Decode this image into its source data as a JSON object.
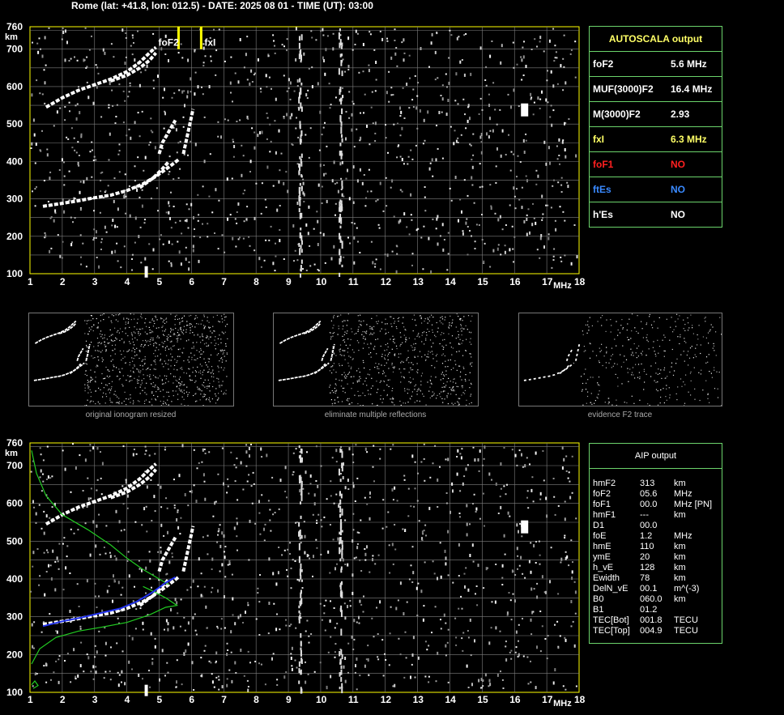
{
  "header": "Rome (lat: +41.8, lon: 012.5) - DATE: 2025 08 01 - TIME (UT): 03:00",
  "chart_data": [
    {
      "type": "scatter",
      "id": "ionogram-top",
      "x_ticks": [
        "1",
        "2",
        "3",
        "4",
        "5",
        "6",
        "7",
        "8",
        "9",
        "10",
        "11",
        "12",
        "13",
        "14",
        "15",
        "16",
        "17",
        "18"
      ],
      "y_ticks": [
        "100",
        "200",
        "300",
        "400",
        "500",
        "600",
        "700",
        "760"
      ],
      "x_unit": "MHz",
      "y_unit": "km",
      "xlim": [
        1,
        18
      ],
      "ylim": [
        100,
        760
      ],
      "grid": true,
      "markers": [
        {
          "name": "foF2",
          "x": 5.6,
          "color": "#ffff00"
        },
        {
          "name": "fxI",
          "x": 6.3,
          "color": "#ffff00"
        }
      ],
      "traces": [
        {
          "points": [
            [
              1.5,
              545
            ],
            [
              2.0,
              570
            ],
            [
              2.5,
              590
            ],
            [
              3.0,
              605
            ],
            [
              3.5,
              620
            ],
            [
              4.0,
              640
            ],
            [
              4.4,
              665
            ],
            [
              4.7,
              690
            ],
            [
              4.9,
              705
            ]
          ]
        },
        {
          "points": [
            [
              3.5,
              615
            ],
            [
              4.0,
              630
            ],
            [
              4.4,
              650
            ],
            [
              4.7,
              670
            ],
            [
              4.9,
              690
            ]
          ]
        },
        {
          "points": [
            [
              1.4,
              280
            ],
            [
              2.0,
              288
            ],
            [
              2.5,
              295
            ],
            [
              3.0,
              303
            ],
            [
              3.5,
              310
            ],
            [
              4.0,
              322
            ],
            [
              4.5,
              340
            ],
            [
              4.9,
              360
            ],
            [
              5.3,
              385
            ],
            [
              5.6,
              405
            ]
          ]
        },
        {
          "points": [
            [
              4.4,
              330
            ],
            [
              4.8,
              355
            ],
            [
              5.1,
              380
            ],
            [
              5.3,
              400
            ]
          ]
        },
        {
          "points": [
            [
              5.0,
              420
            ],
            [
              5.1,
              450
            ],
            [
              5.3,
              480
            ],
            [
              5.5,
              510
            ]
          ]
        },
        {
          "points": [
            [
              5.75,
              420
            ],
            [
              5.85,
              460
            ],
            [
              5.95,
              500
            ],
            [
              6.05,
              540
            ]
          ]
        }
      ]
    },
    {
      "type": "scatter",
      "id": "ionogram-bottom",
      "x_ticks": [
        "1",
        "2",
        "3",
        "4",
        "5",
        "6",
        "7",
        "8",
        "9",
        "10",
        "11",
        "12",
        "13",
        "14",
        "15",
        "16",
        "17",
        "18"
      ],
      "y_ticks": [
        "100",
        "200",
        "300",
        "400",
        "500",
        "600",
        "700",
        "760"
      ],
      "x_unit": "MHz",
      "y_unit": "km",
      "xlim": [
        1,
        18
      ],
      "ylim": [
        100,
        760
      ],
      "grid": true,
      "traces": [
        {
          "points": [
            [
              1.5,
              545
            ],
            [
              2.0,
              570
            ],
            [
              2.5,
              590
            ],
            [
              3.0,
              605
            ],
            [
              3.5,
              620
            ],
            [
              4.0,
              640
            ],
            [
              4.4,
              665
            ],
            [
              4.7,
              690
            ],
            [
              4.9,
              705
            ]
          ]
        },
        {
          "points": [
            [
              3.5,
              615
            ],
            [
              4.0,
              630
            ],
            [
              4.4,
              650
            ],
            [
              4.7,
              670
            ],
            [
              4.9,
              690
            ]
          ]
        },
        {
          "points": [
            [
              1.4,
              280
            ],
            [
              2.0,
              288
            ],
            [
              2.5,
              295
            ],
            [
              3.0,
              303
            ],
            [
              3.5,
              310
            ],
            [
              4.0,
              322
            ],
            [
              4.5,
              340
            ],
            [
              4.9,
              360
            ],
            [
              5.3,
              385
            ],
            [
              5.6,
              405
            ]
          ]
        },
        {
          "points": [
            [
              4.4,
              330
            ],
            [
              4.8,
              355
            ],
            [
              5.1,
              380
            ],
            [
              5.3,
              400
            ]
          ]
        },
        {
          "points": [
            [
              5.0,
              420
            ],
            [
              5.1,
              450
            ],
            [
              5.3,
              480
            ],
            [
              5.5,
              510
            ]
          ]
        },
        {
          "points": [
            [
              5.75,
              420
            ],
            [
              5.85,
              460
            ],
            [
              5.95,
              500
            ],
            [
              6.05,
              540
            ]
          ]
        }
      ],
      "lines": [
        {
          "color": "#22cc22",
          "points": [
            [
              1.05,
              740
            ],
            [
              1.2,
              680
            ],
            [
              1.5,
              620
            ],
            [
              2.0,
              570
            ],
            [
              2.8,
              530
            ],
            [
              3.5,
              490
            ],
            [
              4.0,
              455
            ],
            [
              4.5,
              425
            ],
            [
              5.0,
              400
            ],
            [
              5.3,
              385
            ]
          ]
        },
        {
          "color": "#22cc22",
          "points": [
            [
              1.05,
              175
            ],
            [
              1.3,
              215
            ],
            [
              1.8,
              245
            ],
            [
              2.5,
              262
            ],
            [
              3.2,
              272
            ],
            [
              4.0,
              285
            ],
            [
              4.7,
              305
            ],
            [
              5.2,
              325
            ],
            [
              5.55,
              330
            ],
            [
              5.2,
              350
            ],
            [
              4.8,
              368
            ],
            [
              4.5,
              380
            ]
          ]
        },
        {
          "color": "#22cc22",
          "points": [
            [
              1.05,
              120
            ],
            [
              1.15,
              130
            ],
            [
              1.25,
              118
            ],
            [
              1.1,
              110
            ]
          ]
        },
        {
          "color": "#2233ee",
          "points": [
            [
              1.4,
              275
            ],
            [
              2.0,
              288
            ],
            [
              2.6,
              298
            ],
            [
              3.2,
              310
            ],
            [
              3.8,
              322
            ],
            [
              4.3,
              340
            ],
            [
              4.8,
              365
            ],
            [
              5.2,
              390
            ],
            [
              5.5,
              405
            ]
          ]
        }
      ]
    }
  ],
  "thumbnails": [
    {
      "caption": "original ionogram resized"
    },
    {
      "caption": "eliminate multiple reflections"
    },
    {
      "caption": "evidence F2 trace"
    }
  ],
  "autoscala": {
    "title": "AUTOSCALA output",
    "rows": [
      {
        "label": "foF2",
        "value": "5.6 MHz",
        "label_color": "#ffffff",
        "value_color": "#ffffff"
      },
      {
        "label": "MUF(3000)F2",
        "value": "16.4 MHz",
        "label_color": "#ffffff",
        "value_color": "#ffffff"
      },
      {
        "label": "M(3000)F2",
        "value": "2.93",
        "label_color": "#ffffff",
        "value_color": "#ffffff"
      },
      {
        "label": "fxI",
        "value": "6.3 MHz",
        "label_color": "#ffff66",
        "value_color": "#ffff66"
      },
      {
        "label": "foF1",
        "value": "NO",
        "label_color": "#ff2020",
        "value_color": "#ff2020"
      },
      {
        "label": "ftEs",
        "value": "NO",
        "label_color": "#3a8aff",
        "value_color": "#3a8aff"
      },
      {
        "label": "h'Es",
        "value": "NO",
        "label_color": "#ffffff",
        "value_color": "#ffffff"
      }
    ]
  },
  "aip": {
    "title": "AIP output",
    "rows": [
      {
        "name": "hmF2",
        "value": "313",
        "unit": "km"
      },
      {
        "name": "foF2",
        "value": "05.6",
        "unit": "MHz"
      },
      {
        "name": "foF1",
        "value": "00.0",
        "unit": "MHz   [PN]"
      },
      {
        "name": "hmF1",
        "value": "---",
        "unit": "km"
      },
      {
        "name": "D1",
        "value": "00.0",
        "unit": ""
      },
      {
        "name": "foE",
        "value": "1.2",
        "unit": "MHz"
      },
      {
        "name": "hmE",
        "value": "110",
        "unit": "km"
      },
      {
        "name": "ymE",
        "value": "20",
        "unit": "km"
      },
      {
        "name": "h_vE",
        "value": "128",
        "unit": "km"
      },
      {
        "name": "Ewidth",
        "value": "78",
        "unit": "km"
      },
      {
        "name": "DelN_vE",
        "value": "00.1",
        "unit": "m^(-3)"
      },
      {
        "name": "B0",
        "value": "060.0",
        "unit": "km"
      },
      {
        "name": "B1",
        "value": "01.2",
        "unit": ""
      },
      {
        "name": "TEC[Bot]",
        "value": "001.8",
        "unit": "TECU"
      },
      {
        "name": "TEC[Top]",
        "value": "004.9",
        "unit": "TECU"
      }
    ]
  }
}
